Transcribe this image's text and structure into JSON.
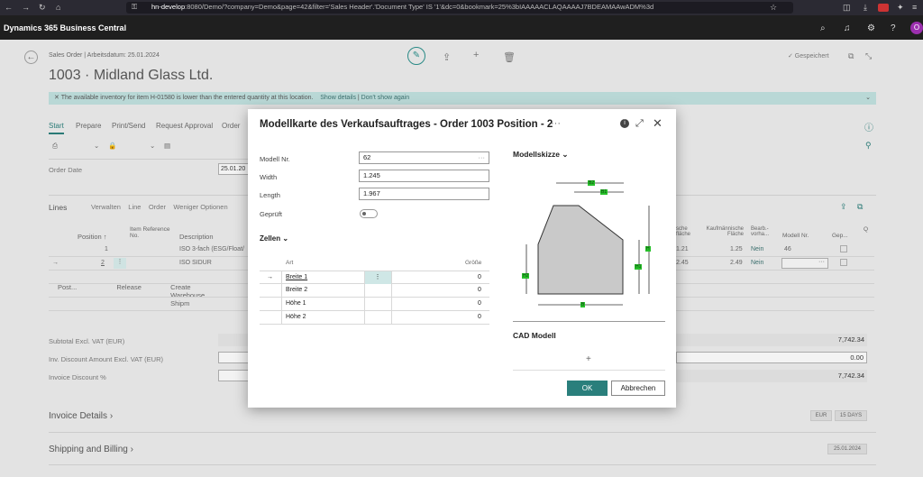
{
  "browser": {
    "url_host": "hn-develop",
    "url_rest": ":8080/Demo/?company=Demo&page=42&filter='Sales Header'.'Document Type' IS '1'&dc=0&bookmark=25%3bIAAAAACLAQAAAAJ7BDEAMAAwADM%3d"
  },
  "app": {
    "title": "Dynamics 365 Business Central",
    "avatar": "O"
  },
  "page": {
    "breadcrumb": "Sales Order | Arbeitsdatum: 25.01.2024",
    "title": "1003 · Midland Glass Ltd.",
    "saved": "✓ Gespeichert",
    "notice": {
      "text": "The available inventory for item H-01580 is lower than the entered quantity at this location.",
      "show_details": "Show details",
      "dont_show": "Don't show again"
    },
    "tabs": [
      "Start",
      "Prepare",
      "Print/Send",
      "Request Approval",
      "Order"
    ],
    "toolbar": {
      "post": "Post...",
      "release": "Release",
      "create_shipment": "Create Warehouse Shipm"
    },
    "order_date_label": "Order Date",
    "order_date_value": "25.01.20",
    "lines": {
      "title": "Lines",
      "menu": [
        "Verwalten",
        "Line",
        "Order",
        "Weniger Optionen"
      ],
      "headers": {
        "position": "Position ↑",
        "item_ref": "Item Reference No.",
        "description": "Description",
        "fache": "sche\nfläche",
        "kaufm_flache": "Kaufmännische Fläche",
        "bearb": "Bearb.-vorha...",
        "modell_nr": "Modell Nr.",
        "gepr": "Gep...",
        "q": "Q"
      },
      "rows": [
        {
          "pos": "1",
          "desc": "ISO 3-fach (ESG/Float/",
          "fl": "1.21",
          "kf": "1.25",
          "bearb": "Nein",
          "modell": "46"
        },
        {
          "pos": "2",
          "desc": "ISO SIDUR",
          "fl": "2.45",
          "kf": "2.49",
          "bearb": "Nein",
          "modell": ""
        }
      ]
    },
    "totals": [
      {
        "label": "Subtotal Excl. VAT (EUR)",
        "value": "7,742.34"
      },
      {
        "label": "Inv. Discount Amount Excl. VAT (EUR)",
        "value": "0.00"
      },
      {
        "label": "Invoice Discount %",
        "value": "7,742.34"
      }
    ],
    "invoice_details": {
      "title": "Invoice Details",
      "chips": [
        "EUR",
        "15 DAYS"
      ]
    },
    "shipping_billing": {
      "title": "Shipping and Billing",
      "chips": [
        "25.01.2024"
      ]
    }
  },
  "modal": {
    "title": "Modellkarte des Verkaufsauftrages - Order 1003 Position - 2",
    "fields": [
      {
        "label": "Modell Nr.",
        "value": "62"
      },
      {
        "label": "Width",
        "value": "1.245"
      },
      {
        "label": "Length",
        "value": "1.967"
      }
    ],
    "gepruft_label": "Geprüft",
    "zellen_title": "Zellen",
    "table": {
      "col_art": "Art",
      "col_grosse": "Größe",
      "rows": [
        {
          "art": "Breite 1",
          "grosse": "0"
        },
        {
          "art": "Breite 2",
          "grosse": "0"
        },
        {
          "art": "Höhe 1",
          "grosse": "0"
        },
        {
          "art": "Höhe 2",
          "grosse": "0"
        }
      ]
    },
    "skizze_title": "Modellskizze",
    "sketch_labels": {
      "b2": "B2",
      "b1": "B1",
      "h": "H",
      "h1": "H1",
      "h2": "H2",
      "b": "B"
    },
    "cad_title": "CAD Modell",
    "ok": "OK",
    "cancel": "Abbrechen"
  },
  "colors": {
    "accent": "#2a7f7c",
    "dim_label": "#27c02a",
    "notice": "#b9d8d6"
  }
}
